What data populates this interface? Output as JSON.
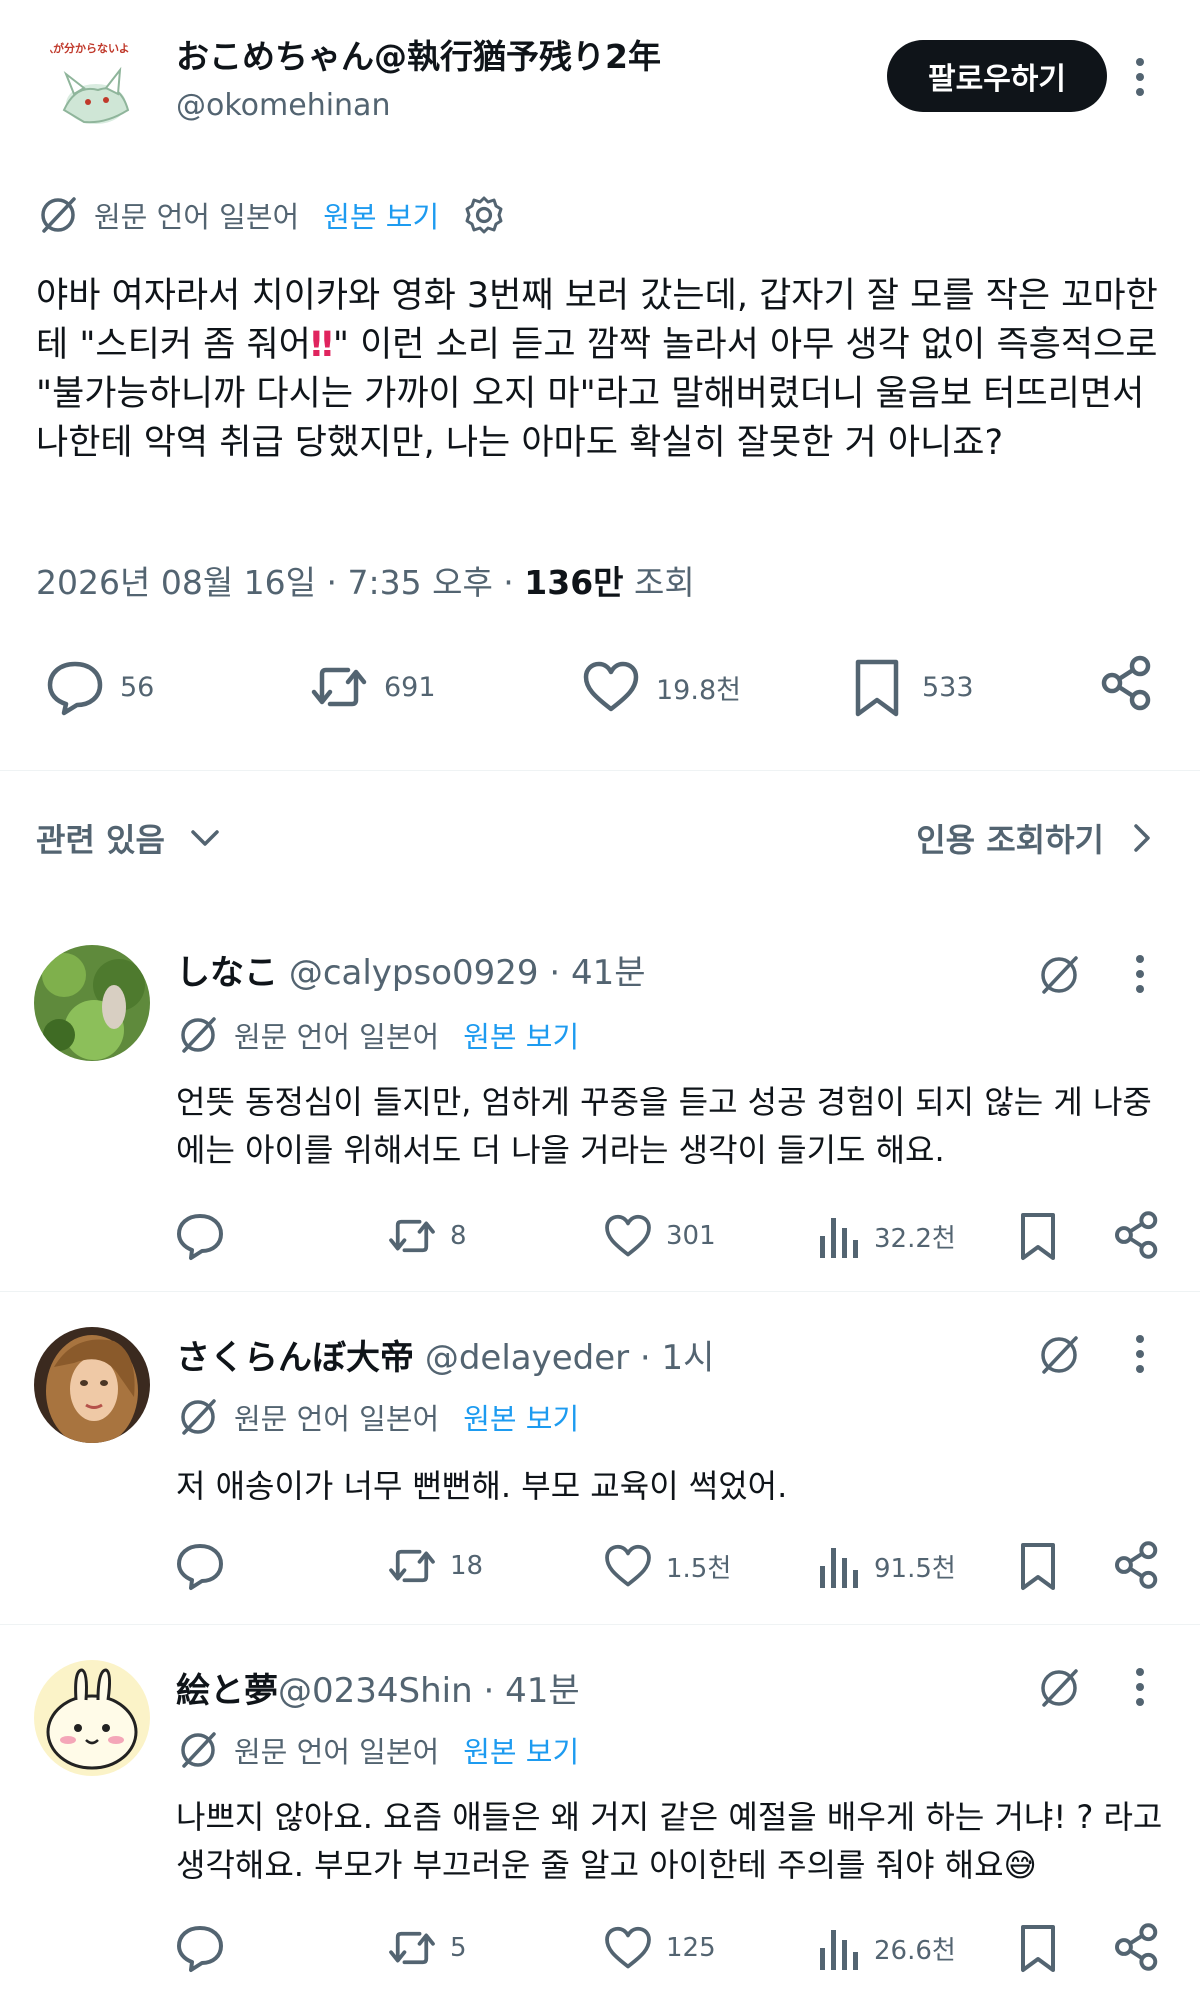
{
  "main_tweet": {
    "avatar_label": "訳が分からないよ",
    "display_name": "おこめちゃん@執行猶予残り2年",
    "handle": "@okomehinan",
    "follow_label": "팔로우하기",
    "translation": {
      "label": "원문 언어 일본어",
      "link": "원본 보기"
    },
    "text_part1": "야바 여자라서 치이카와 영화 3번째 보러 갔는데, 갑자기 잘 모를 작은 꼬마한테 \"스티커 좀 줘어",
    "text_bangs": "‼",
    "text_part2": "\" 이런 소리 듣고 깜짝 놀라서 아무 생각 없이 즉흥적으로 \"불가능하니까 다시는 가까이 오지 마\"라고 말해버렸더니 울음보 터뜨리면서 나한테 악역 취급 당했지만, 나는 아마도 확실히 잘못한 거 아니죠?",
    "date": "2026년 08월 16일 · 7:35 오후 · ",
    "views_count": "136만",
    "views_label": " 조회",
    "stats": {
      "replies": "56",
      "retweets": "691",
      "likes": "19.8천",
      "bookmarks": "533"
    }
  },
  "related": {
    "label": "관련 있음",
    "quotes_label": "인용 조회하기"
  },
  "replies": [
    {
      "name": "しなこ",
      "handle": "@calypso0929",
      "time": " · 41분",
      "translation": {
        "label": "원문 언어 일본어",
        "link": "원본 보기"
      },
      "text": "언뜻 동정심이 들지만, 엄하게 꾸중을 듣고 성공 경험이 되지 않는 게 나중에는 아이를 위해서도 더 나을 거라는 생각이 들기도 해요.",
      "stats": {
        "retweets": "8",
        "likes": "301",
        "views": "32.2천"
      }
    },
    {
      "name": "さくらんぼ大帝",
      "handle": "@delayeder",
      "time": " · 1시",
      "translation": {
        "label": "원문 언어 일본어",
        "link": "원본 보기"
      },
      "text": "저 애송이가 너무 뻔뻔해. 부모 교육이 썩었어.",
      "stats": {
        "retweets": "18",
        "likes": "1.5천",
        "views": "91.5천"
      }
    },
    {
      "name": "絵と夢",
      "handle": "@0234Shin",
      "time": " · 41분",
      "translation": {
        "label": "원문 언어 일본어",
        "link": "원본 보기"
      },
      "text": "나쁘지 않아요. 요즘 애들은 왜 거지 같은 예절을 배우게 하는 거냐! ? 라고 생각해요. 부모가 부끄러운 줄 알고 아이한테 주의를 줘야 해요😅",
      "stats": {
        "retweets": "5",
        "likes": "125",
        "views": "26.6천"
      }
    }
  ],
  "colors": {
    "text": "#0f1419",
    "secondary": "#536471",
    "link": "#1d9bf0",
    "divider": "#eff3f4",
    "follow_bg": "#0f1419"
  }
}
